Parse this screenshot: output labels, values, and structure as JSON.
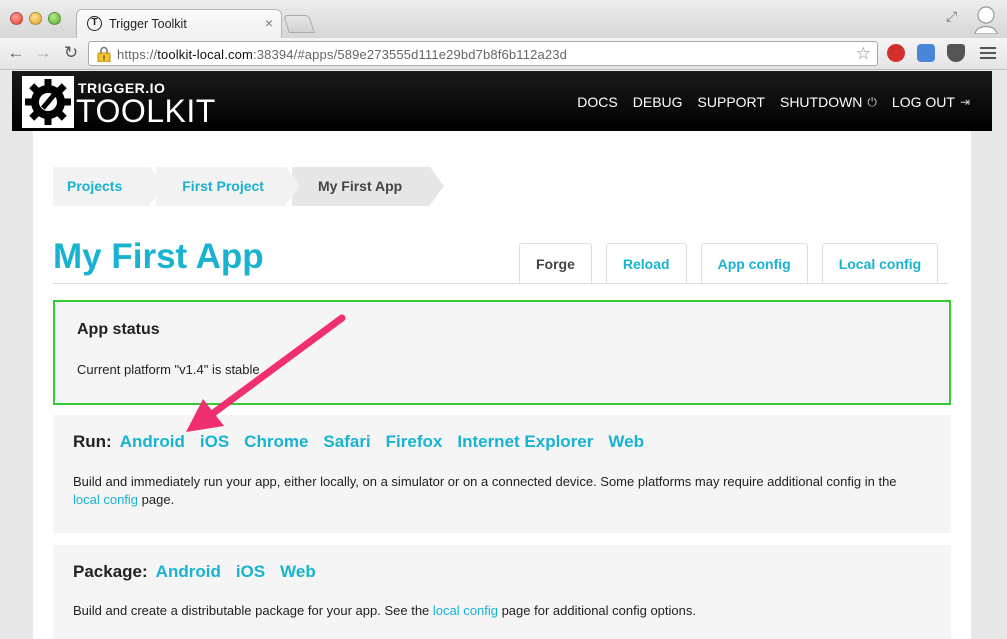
{
  "browser": {
    "tab_title": "Trigger Toolkit",
    "tab_favicon_letter": "T",
    "url_scheme": "https://",
    "url_host": "toolkit-local.com",
    "url_rest": ":38394/#apps/589e273555d111e29bd7b8f6b112a23d"
  },
  "brand": {
    "small": "TRIGGER.IO",
    "big": "TOOLKIT"
  },
  "topnav": {
    "docs": "DOCS",
    "debug": "DEBUG",
    "support": "SUPPORT",
    "shutdown": "SHUTDOWN",
    "logout": "LOG OUT"
  },
  "breadcrumbs": [
    "Projects",
    "First Project",
    "My First App"
  ],
  "page_title": "My First App",
  "tabs": [
    "Forge",
    "Reload",
    "App config",
    "Local config"
  ],
  "status": {
    "heading": "App status",
    "text": "Current platform \"v1.4\" is stable"
  },
  "run": {
    "label": "Run:",
    "platforms": [
      "Android",
      "iOS",
      "Chrome",
      "Safari",
      "Firefox",
      "Internet Explorer",
      "Web"
    ],
    "desc_before": "Build and immediately run your app, either locally, on a simulator or on a connected device. Some platforms may require additional config in the ",
    "desc_link": "local config",
    "desc_after": " page."
  },
  "package": {
    "label": "Package:",
    "platforms": [
      "Android",
      "iOS",
      "Web"
    ],
    "desc_before": "Build and create a distributable package for your app. See the ",
    "desc_link": "local config",
    "desc_after": " page for additional config options."
  },
  "colors": {
    "accent": "#17b3d1",
    "status_border": "#33cc33",
    "annotation_arrow": "#f0306e"
  }
}
